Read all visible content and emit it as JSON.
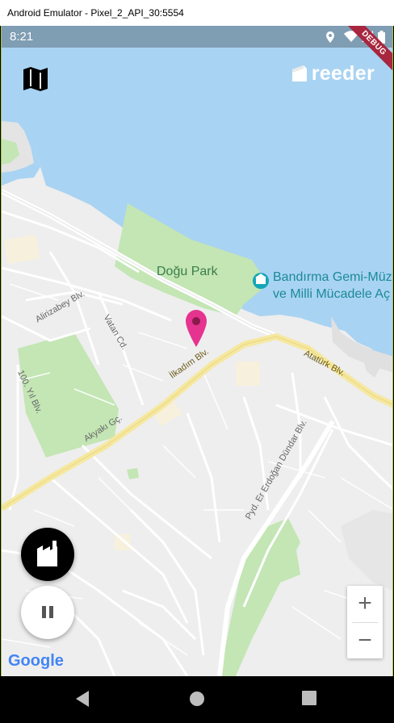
{
  "window": {
    "title": "Android Emulator - Pixel_2_API_30:5554"
  },
  "status_bar": {
    "time": "8:21",
    "icons": [
      "location-icon",
      "wifi-icon",
      "signal-icon",
      "battery-icon"
    ]
  },
  "debug_banner": "DEBUG",
  "header": {
    "map_icon": "map-icon",
    "brand": "reeder"
  },
  "map": {
    "labels": {
      "park": "Doğu Park",
      "museum_line1": "Bandırma Gemi-Müze",
      "museum_line2": "ve Milli Mücadele Aç",
      "street_alirizabey": "Alirizabey Blv.",
      "street_vatan": "Vatan Cd.",
      "street_ilkadim": "İlkadım Blv.",
      "street_ataturk": "Atatürk Blv.",
      "street_yil": "100. Yıl Blv.",
      "street_akyaki": "Akyakı Gç.",
      "street_erdogan": "Pyd. Er Erdoğan Dündar Blv."
    },
    "marker_color": "#e5338f",
    "water_color": "#a9d3f2",
    "park_color": "#c3e6b4"
  },
  "controls": {
    "factory_button_icon": "factory-icon",
    "pause_button_icon": "pause-icon",
    "zoom_in": "+",
    "zoom_out": "−"
  },
  "attribution": "Google",
  "nav_bar": {
    "back": "back-icon",
    "home": "home-icon",
    "recents": "recents-icon"
  }
}
